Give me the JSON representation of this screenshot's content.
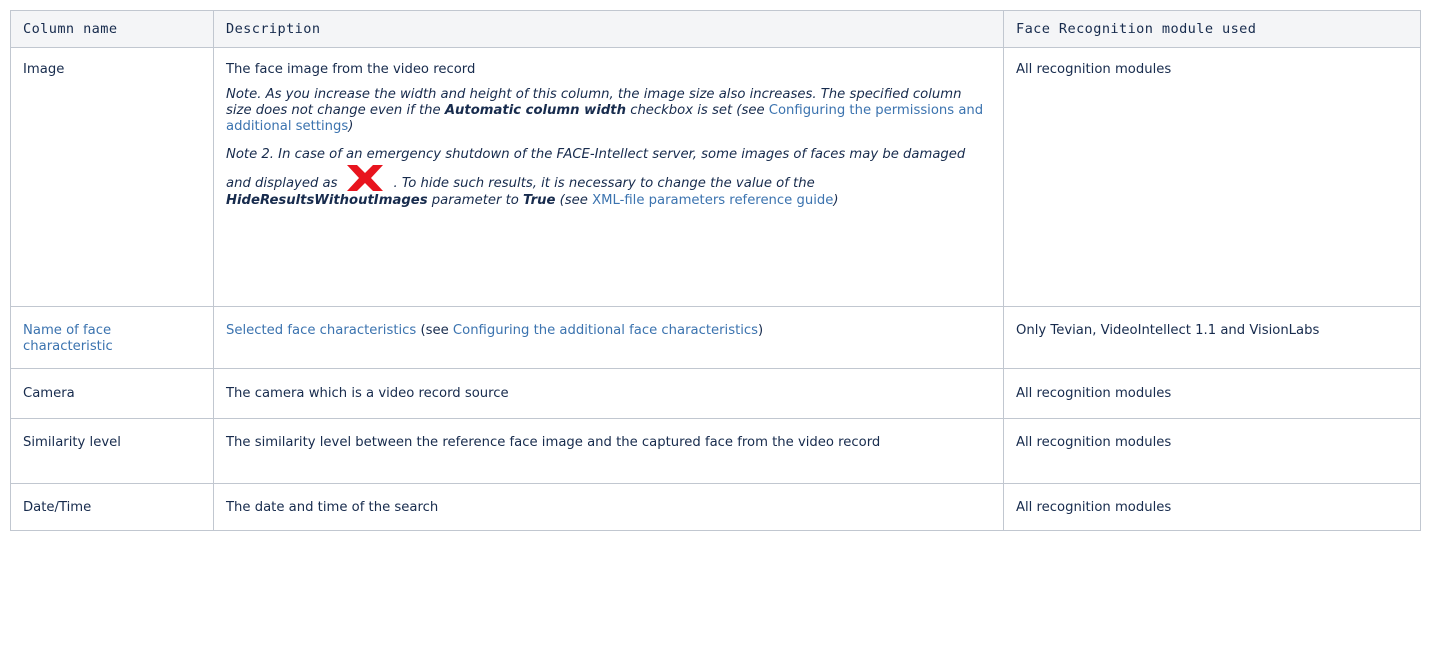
{
  "headers": {
    "col1": "Column name",
    "col2": "Description",
    "col3": "Face Recognition module used"
  },
  "rows": [
    {
      "name": "Image",
      "description": "The face image from the video record",
      "note1": {
        "text_a": "Note. As you increase the width and height of this column, the image size also increases. The specified column size does not change even if the ",
        "bold": "Automatic column width",
        "text_b": " checkbox is set (see ",
        "link": "Configuring the permissions and additional settings",
        "text_c": ")"
      },
      "note2": {
        "text_a": "Note 2. In case of an emergency shutdown of the FACE-Intellect server, some images of faces may be damaged and displayed as",
        "icon": "red-x-icon",
        "text_b": ". To hide such results, it is necessary to change the value of the ",
        "bold1": "HideResultsWithoutImages",
        "text_c": " parameter to ",
        "bold2": "True",
        "text_d": " (see ",
        "link": "XML-file parameters reference guide",
        "text_e": ")"
      },
      "module": "All recognition modules"
    },
    {
      "name": "Name of face characteristic",
      "description_link": "Selected face characteristics",
      "description_mid": " (see ",
      "description_link2": "Configuring the additional face characteristics",
      "description_end": ")",
      "module": "Only Tevian, VideoIntellect 1.1 and VisionLabs"
    },
    {
      "name": "Camera",
      "description": "The camera which is a video record source",
      "module": "All recognition modules"
    },
    {
      "name": "Similarity level",
      "description": "The similarity level between the reference face image and the captured face from the video record",
      "module": "All recognition modules"
    },
    {
      "name": "Date/Time",
      "description": "The date and time of the search",
      "module": "All recognition modules"
    }
  ],
  "colors": {
    "link": "#3b73af",
    "header_bg": "#f4f5f7",
    "border": "#c1c7d0",
    "icon_red": "#e8141e"
  }
}
